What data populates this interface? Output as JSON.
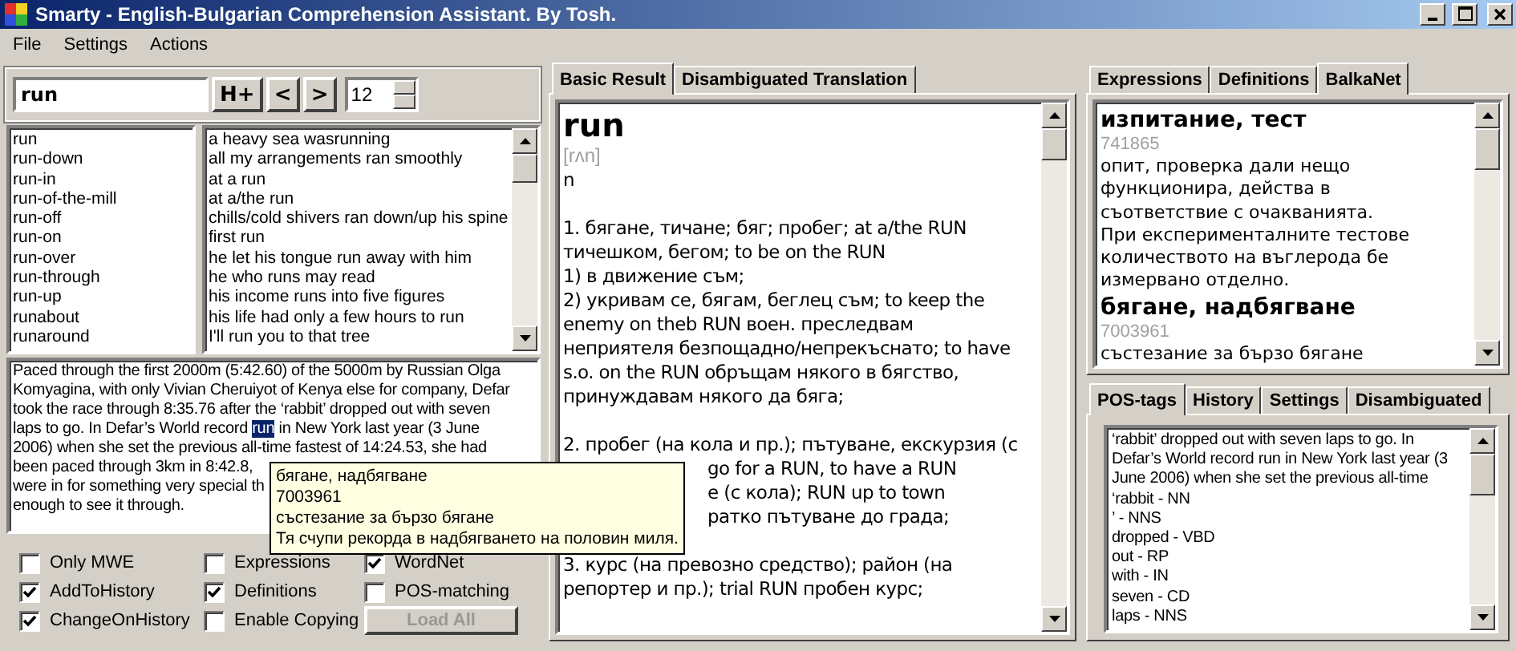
{
  "window": {
    "title": "Smarty - English-Bulgarian Comprehension Assistant. By Tosh."
  },
  "menu": [
    "File",
    "Settings",
    "Actions"
  ],
  "toolbar": {
    "search_value": "run",
    "buttons": [
      "H+",
      "<",
      ">"
    ],
    "spin_value": "12"
  },
  "headwords": [
    "run",
    "run-down",
    "run-in",
    "run-of-the-mill",
    "run-off",
    "run-on",
    "run-over",
    "run-through",
    "run-up",
    "runabout",
    "runaround"
  ],
  "expressions": [
    "a heavy sea wasrunning",
    "all my arrangements ran smoothly",
    "at a run",
    "at a/the run",
    "chills/cold shivers ran down/up his spine",
    "first run",
    "he let his tongue run away with him",
    "he who runs may read",
    "his income runs into five figures",
    "his life had only a few hours to run",
    "I'll run you to that tree"
  ],
  "passage": [
    {
      "text": "Paced through the first 2000m (5:42.60) of the 5000m by Russian Olga"
    },
    {
      "text": "Komyagina, with only Vivian Cheruiyot of Kenya else for company, Defar"
    },
    {
      "text": "took the race through 8:35.76 after the ‘rabbit’ dropped out with seven"
    },
    {
      "text": "laps to go. In Defar’s World record ",
      "highlight": "run",
      "rest": " in New York last year (3 June"
    },
    {
      "text": "2006) when she set the previous all-time fastest of 14:24.53, she had"
    },
    {
      "text": "been paced through 3km in 8:42.8,"
    },
    {
      "text": "were in for something very special th"
    },
    {
      "text": "enough to see it through."
    }
  ],
  "tooltip": [
    "бягане, надбягване",
    "7003961",
    "състезание за бързо бягане",
    "Тя счупи рекорда в надбягването на половин миля."
  ],
  "options": [
    {
      "label": "Only MWE",
      "checked": false
    },
    {
      "label": "AddToHistory",
      "checked": true
    },
    {
      "label": "ChangeOnHistory",
      "checked": true
    },
    {
      "label": "Expressions",
      "checked": false
    },
    {
      "label": "Definitions",
      "checked": true
    },
    {
      "label": "Enable Copying",
      "checked": false
    },
    {
      "label": "WordNet",
      "checked": true
    },
    {
      "label": "POS-matching",
      "checked": false
    }
  ],
  "load_all": {
    "label": "Load All",
    "disabled": true
  },
  "result_tabs": [
    {
      "label": "Basic Result",
      "selected": true
    },
    {
      "label": "Disambiguated Translation",
      "selected": false
    }
  ],
  "result": {
    "headword": "run",
    "transcription": "[rʌn]",
    "pos": "n",
    "paragraphs": [
      {
        "lines": [
          "1.  бягане, тичане; бяг; пробег; at a/the RUN",
          "тичешком, бегом; to be on the RUN",
          "1) в движение съм;",
          "2) укривам се, бягам, беглец съм; to keep the",
          "enemy on theb RUN воен. преследвам",
          "неприятеля безпощадно/непрекъснато; to have",
          "s.o. on the RUN обръщам някого в бягство,",
          "принуждавам някого да бяга;"
        ]
      },
      {
        "lines": [
          "2.  пробег (на кола и пр.); пътуване, екскурзия (с"
        ],
        "covered_lines": [
          "go for a RUN, to have a RUN",
          "е (с кола); RUN up to town",
          "ратко пътуване до града;"
        ]
      },
      {
        "lines": [
          "3.  курс (на превозно средство); район (на",
          "репортер и пр.); trial RUN пробен курс;"
        ]
      }
    ]
  },
  "side_tabs": [
    {
      "label": "Expressions",
      "selected": false
    },
    {
      "label": "Definitions",
      "selected": false
    },
    {
      "label": "BalkaNet",
      "selected": true
    }
  ],
  "balkanet": [
    {
      "title": "изпитание, тест",
      "id": "741865",
      "lines": [
        "опит, проверка дали нещо",
        "функционира, действа в",
        "съответствие с очакванията.",
        "При експерименталните тестове",
        "количеството на въглерода бе",
        "измервано отделно."
      ]
    },
    {
      "title": "бягане, надбягване",
      "id": "7003961",
      "lines": [
        "състезание за бързо бягане"
      ]
    }
  ],
  "bottom_tabs": [
    {
      "label": "POS-tags",
      "selected": true
    },
    {
      "label": "History",
      "selected": false
    },
    {
      "label": "Settings",
      "selected": false
    },
    {
      "label": "Disambiguated",
      "selected": false
    }
  ],
  "pos_lines": [
    "‘rabbit’ dropped out with seven laps to go. In",
    "Defar’s World record run in New York last year (3",
    "June 2006) when she set the previous all-time",
    "‘rabbit - NN",
    "’ - NNS",
    "dropped - VBD",
    "out - RP",
    "with - IN",
    "seven - CD",
    "laps - NNS"
  ]
}
